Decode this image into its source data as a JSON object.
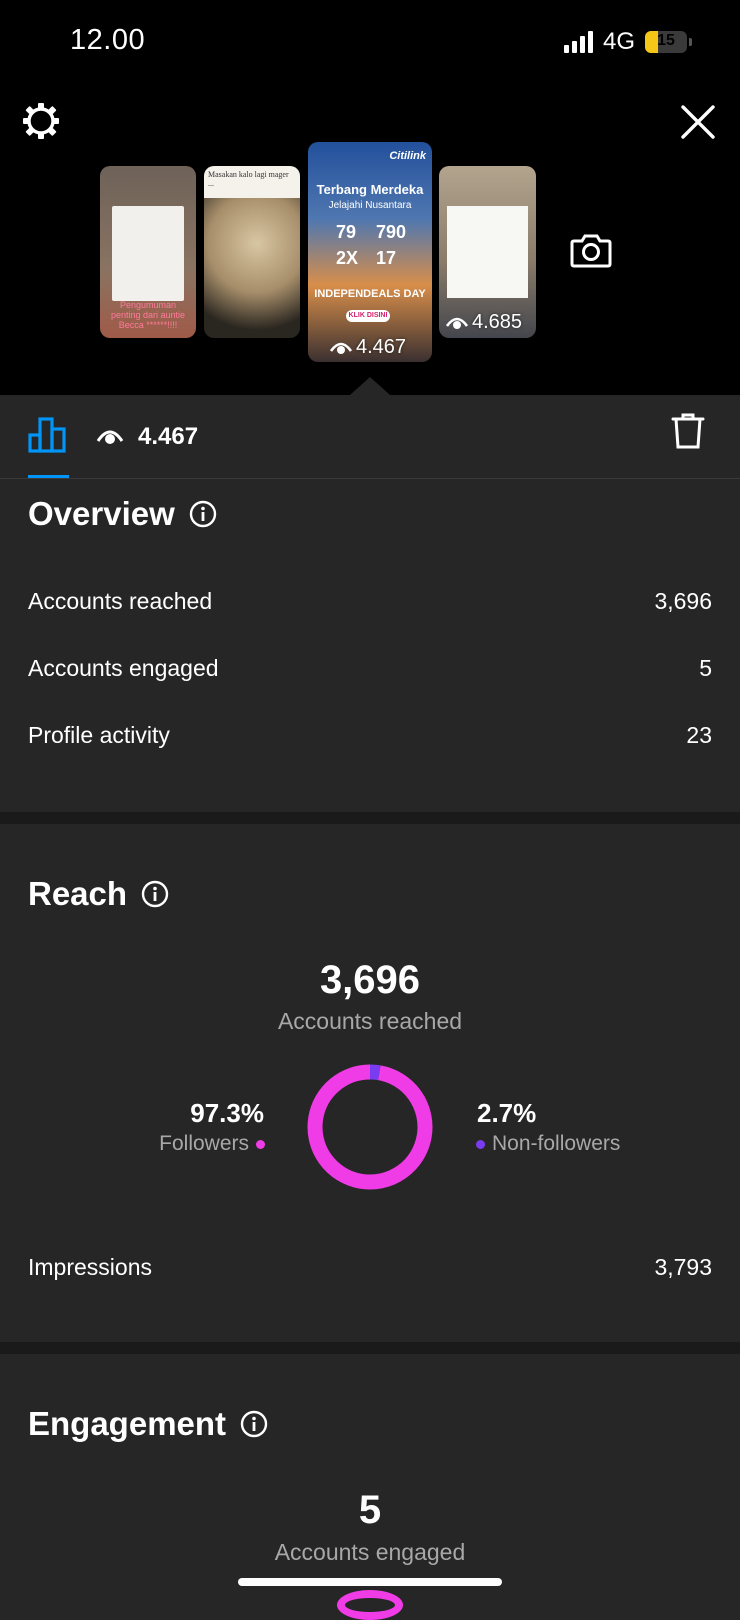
{
  "status": {
    "time": "12.00",
    "network": "4G",
    "battery": "15"
  },
  "stories": {
    "thumb1_caption": "Pengumuman penting dari auntie Becca ******!!!!",
    "thumb2_caption": "Masakan kalo lagi mager ...",
    "thumb3": {
      "brand": "Citilink",
      "headline": "Terbang Merdeka",
      "subheadline": "Jelajahi Nusantara",
      "n1": "79",
      "n2": "790",
      "n3": "2X",
      "n4": "17",
      "banner": "INDEPENDEALS DAY",
      "button": "KLIK DISINI",
      "views": "4.467"
    },
    "thumb4_views": "4.685"
  },
  "tabbar": {
    "views": "4.467"
  },
  "overview": {
    "title": "Overview",
    "rows": [
      {
        "label": "Accounts reached",
        "value": "3,696"
      },
      {
        "label": "Accounts engaged",
        "value": "5"
      },
      {
        "label": "Profile activity",
        "value": "23"
      }
    ]
  },
  "reach": {
    "title": "Reach",
    "total": "3,696",
    "total_label": "Accounts reached",
    "followers_pct": "97.3%",
    "followers_label": "Followers",
    "nonfollowers_pct": "2.7%",
    "nonfollowers_label": "Non-followers",
    "followers_fraction": 0.973,
    "impressions_label": "Impressions",
    "impressions_value": "3,793",
    "colors": {
      "followers": "#f03ce6",
      "nonfollowers": "#7a3cf0"
    }
  },
  "engagement": {
    "title": "Engagement",
    "total": "5",
    "total_label": "Accounts engaged"
  }
}
